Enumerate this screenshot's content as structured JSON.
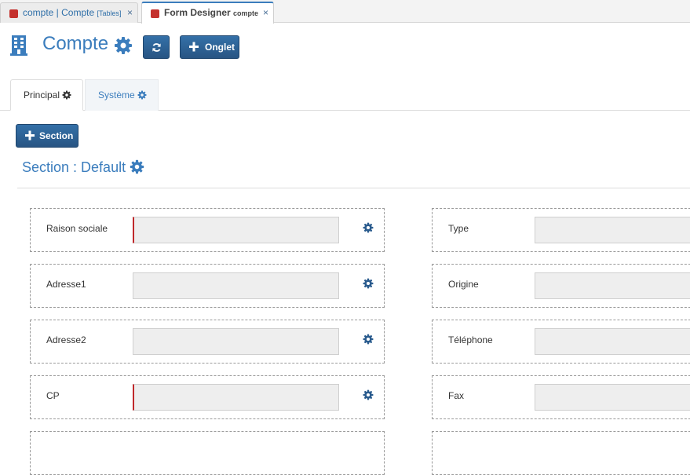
{
  "tabs": [
    {
      "title": "compte | Compte",
      "subtitle": "[Tables]",
      "close": "×"
    },
    {
      "title": "Form Designer",
      "subtitle": "compte",
      "close": "×"
    }
  ],
  "header": {
    "title": "Compte",
    "onglet_label": "Onglet",
    "icons": [
      "building-icon",
      "gear-icon",
      "refresh-icon",
      "plus-icon"
    ]
  },
  "inner_tabs": [
    {
      "label": "Principal"
    },
    {
      "label": "Système"
    }
  ],
  "section_button_label": "Section",
  "section": {
    "title": "Section : Default"
  },
  "fields_left": [
    {
      "label": "Raison sociale",
      "value": "",
      "required": true
    },
    {
      "label": "Adresse1",
      "value": "",
      "required": false
    },
    {
      "label": "Adresse2",
      "value": "",
      "required": false
    },
    {
      "label": "CP",
      "value": "",
      "required": true
    }
  ],
  "fields_right": [
    {
      "label": "Type",
      "value": ""
    },
    {
      "label": "Origine",
      "value": ""
    },
    {
      "label": "Téléphone",
      "value": ""
    },
    {
      "label": "Fax",
      "value": ""
    }
  ],
  "colors": {
    "accent": "#3b7dbd",
    "button": "#2b5c8e",
    "required": "#c0282b",
    "tab_marker": "#c4312d"
  }
}
